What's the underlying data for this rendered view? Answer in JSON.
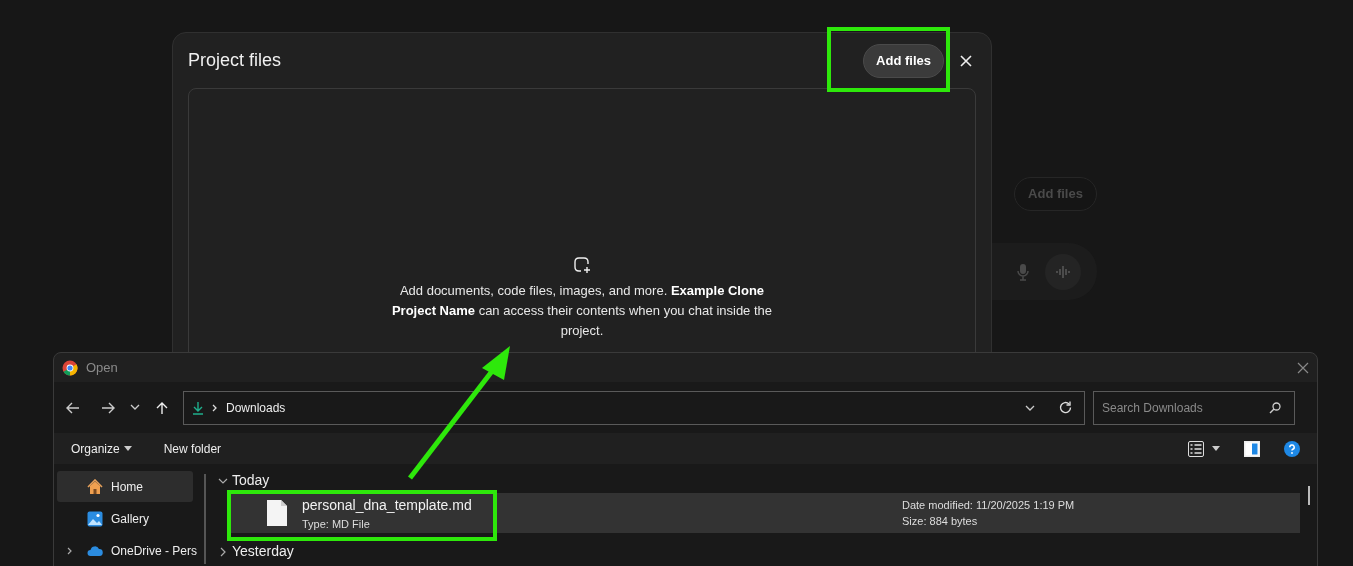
{
  "background": {
    "add_button": "Add files"
  },
  "project_modal": {
    "title": "Project files",
    "add_button": "Add files",
    "dropzone": {
      "text": "Add documents, code files, images, and more. **Example Clone Project Name** can access their contents when you chat inside the project."
    }
  },
  "open_dialog": {
    "title": "Open",
    "address": {
      "location": "Downloads"
    },
    "search": {
      "placeholder": "Search Downloads"
    },
    "toolbar": [
      "Organize",
      "New folder"
    ],
    "sidebar": {
      "items": [
        {
          "label": "Home",
          "kind": "home",
          "selected": true,
          "expandable": false
        },
        {
          "label": "Gallery",
          "kind": "gallery",
          "selected": false,
          "expandable": false
        },
        {
          "label": "OneDrive - Pers",
          "kind": "cloud",
          "selected": false,
          "expandable": true
        }
      ]
    },
    "groups": [
      {
        "label": "Today",
        "expanded": true,
        "files": [
          {
            "name": "personal_dna_template.md",
            "type": "Type: MD File",
            "modified": "Date modified: 11/20/2025 1:19 PM",
            "size": "Size: 884 bytes",
            "selected": true
          }
        ]
      },
      {
        "label": "Yesterday",
        "expanded": false
      }
    ]
  }
}
